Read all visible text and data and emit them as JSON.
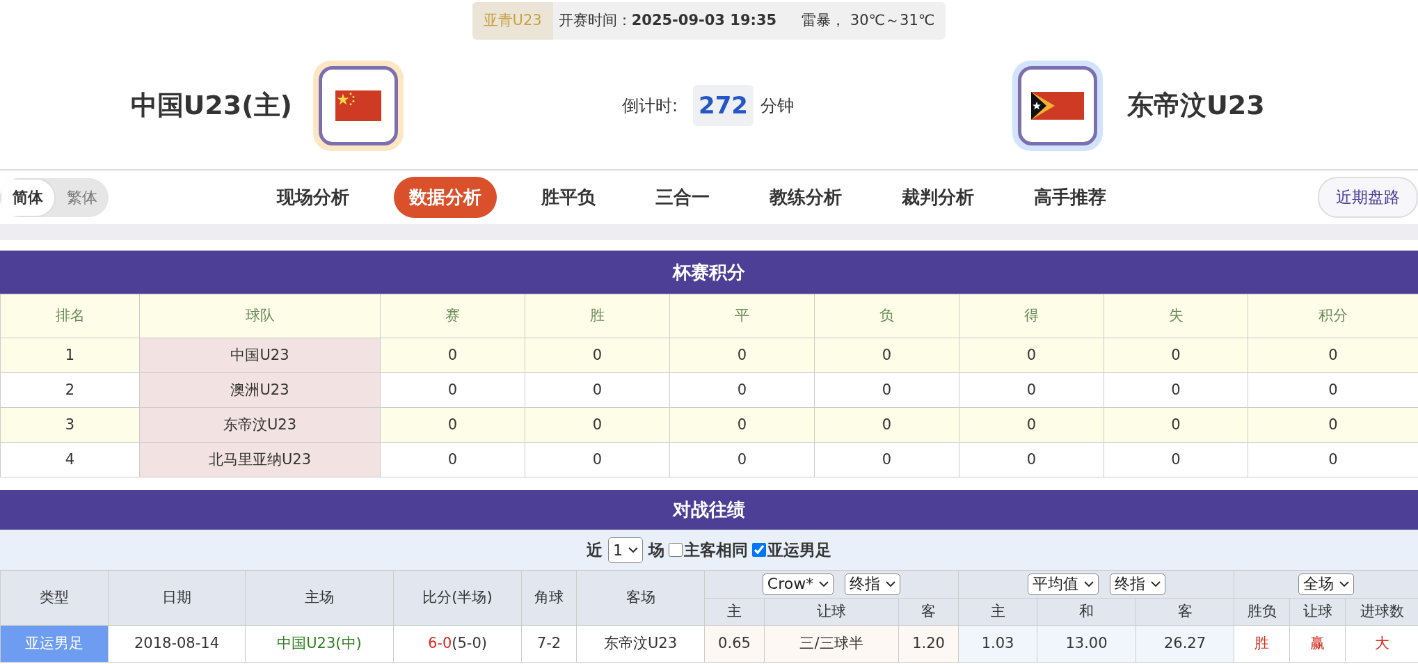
{
  "match_info": {
    "competition": "亚青U23",
    "kickoff_label": "开赛时间：",
    "kickoff_time": "2025-09-03 19:35",
    "weather": "雷暴， 30℃～31℃"
  },
  "home": {
    "name": "中国U23(主)"
  },
  "countdown": {
    "label": "倒计时:",
    "value": "272",
    "unit": "分钟"
  },
  "away": {
    "name": "东帝汶U23"
  },
  "language_toggle": [
    {
      "label": "简体",
      "selected": true
    },
    {
      "label": "繁体",
      "selected": false
    }
  ],
  "nav_tabs": [
    {
      "label": "现场分析",
      "selected": false
    },
    {
      "label": "数据分析",
      "selected": true
    },
    {
      "label": "胜平负",
      "selected": false
    },
    {
      "label": "三合一",
      "selected": false
    },
    {
      "label": "教练分析",
      "selected": false
    },
    {
      "label": "裁判分析",
      "selected": false
    },
    {
      "label": "高手推荐",
      "selected": false
    }
  ],
  "recent_button": "近期盘路",
  "standings": {
    "title": "杯赛积分",
    "columns": [
      "排名",
      "球队",
      "赛",
      "胜",
      "平",
      "负",
      "得",
      "失",
      "积分"
    ],
    "rows": [
      [
        "1",
        "中国U23",
        "0",
        "0",
        "0",
        "0",
        "0",
        "0",
        "0"
      ],
      [
        "2",
        "澳洲U23",
        "0",
        "0",
        "0",
        "0",
        "0",
        "0",
        "0"
      ],
      [
        "3",
        "东帝汶U23",
        "0",
        "0",
        "0",
        "0",
        "0",
        "0",
        "0"
      ],
      [
        "4",
        "北马里亚纳U23",
        "0",
        "0",
        "0",
        "0",
        "0",
        "0",
        "0"
      ]
    ]
  },
  "head_to_head": {
    "title": "对战往绩",
    "filter": {
      "prefix": "近",
      "count": "1",
      "suffix": "场",
      "options": [
        {
          "label": "主客相同",
          "checked": false
        },
        {
          "label": "亚运男足",
          "checked": true
        }
      ]
    },
    "columns": [
      "类型",
      "日期",
      "主场",
      "比分(半场)",
      "角球",
      "客场"
    ],
    "dropdown_groups": [
      [
        "Crow*",
        "终指"
      ],
      [
        "平均值",
        "终指"
      ],
      [
        "全场"
      ]
    ],
    "sub_columns": [
      [
        "主",
        "让球",
        "客"
      ],
      [
        "主",
        "和",
        "客"
      ],
      [
        "胜负",
        "让球",
        "进球数"
      ]
    ],
    "rows": [
      {
        "type": "亚运男足",
        "date": "2018-08-14",
        "home": "中国U23(中)",
        "score": "6-0",
        "half_score": "(5-0)",
        "corners": "7-2",
        "away": "东帝汶U23",
        "handicap": [
          "0.65",
          "三/三球半",
          "1.20"
        ],
        "average": [
          "1.03",
          "13.00",
          "26.27"
        ],
        "results": [
          "胜",
          "赢",
          "大"
        ]
      }
    ]
  }
}
